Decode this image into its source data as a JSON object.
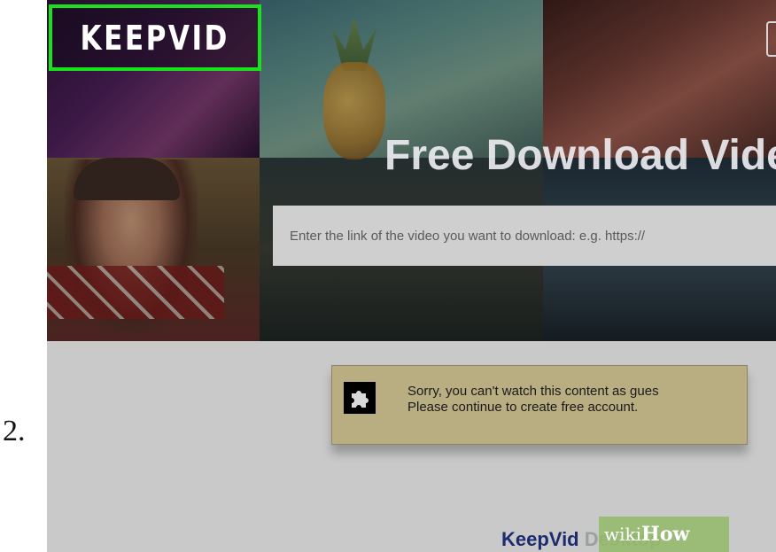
{
  "step": {
    "number": "2."
  },
  "site": {
    "logo": "KEEPVID"
  },
  "hero": {
    "title": "Free Download Vide",
    "search_placeholder": "Enter the link of the video you want to download: e.g. https://"
  },
  "notice": {
    "line1": "Sorry, you can't watch this content as gues",
    "line2": "Please continue to create free account."
  },
  "desktop": {
    "heading_main": "KeepVid",
    "heading_faded": "Desktop"
  },
  "watermark": {
    "wiki": "wiki",
    "how": "How"
  },
  "colors": {
    "highlight_border": "#18e21b",
    "notice_bg": "#b9ad82",
    "heading_blue": "#1c2c6e",
    "watermark_green": "#93ba68"
  },
  "icons": {
    "notice_icon": "puzzle-piece-icon"
  }
}
